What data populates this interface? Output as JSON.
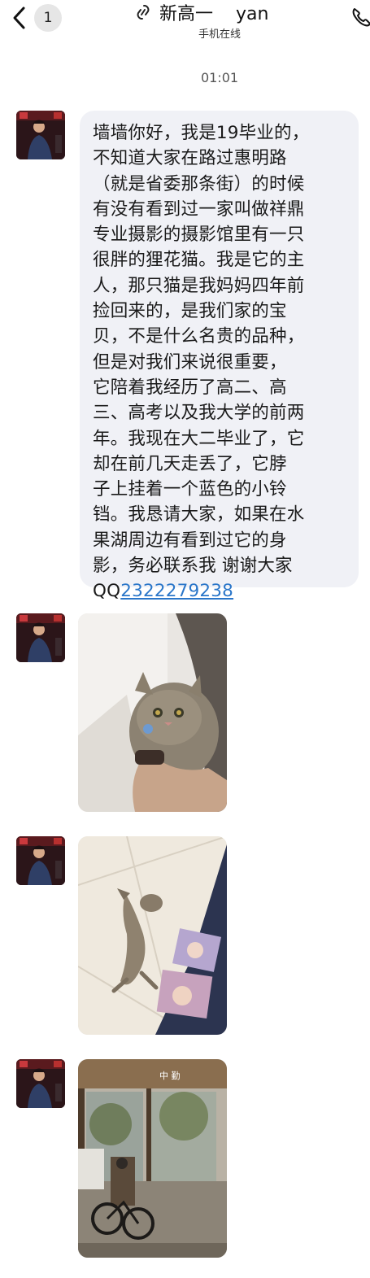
{
  "header": {
    "back_count": "1",
    "title": "新高一    yan",
    "status": "手机在线"
  },
  "timestamp": "01:01",
  "message": {
    "lines": [
      "墙墙你好，我是19毕业的，",
      "不知道大家在路过惠明路",
      "（就是省委那条街）的时候",
      "有没有看到过一家叫做祥鼎",
      "专业摄影的摄影馆里有一只",
      "很胖的狸花猫。我是它的主",
      "人，那只猫是我妈妈四年前",
      "捡回来的，是我们家的宝",
      "贝，不是什么名贵的品种，",
      "但是对我们来说很重要，",
      "它陪着我经历了高二、高",
      "三、高考以及我大学的前两",
      "年。我现在大二毕业了，它",
      "却在前几天走丢了，它脖",
      "子上挂着一个蓝色的小铃",
      "铛。我恳请大家，如果在水",
      "果湖周边有看到过它的身",
      "影，务必联系我 谢谢大家"
    ],
    "qq_prefix": "QQ",
    "qq_number": "2322279238"
  },
  "photo4_sign": "中 勤",
  "icons": {
    "back": "chevron-left-icon",
    "link": "link-icon",
    "phone": "phone-icon"
  },
  "colors": {
    "bubble": "#f0f1f6",
    "link": "#2a76c9",
    "badge": "#e6e6e6"
  }
}
